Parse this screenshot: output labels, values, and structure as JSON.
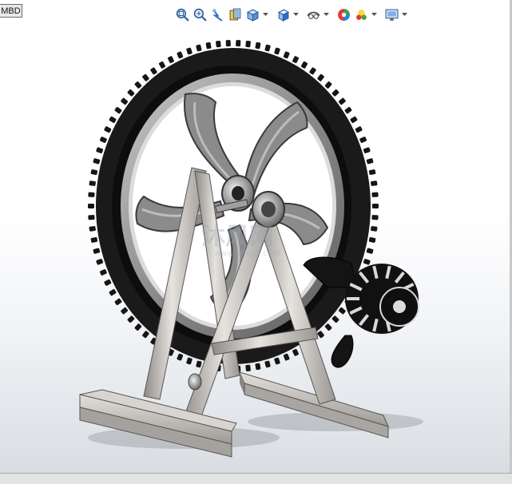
{
  "mbd_tab": {
    "label": "MBD"
  },
  "toolbar": {
    "buttons": [
      {
        "icon": "zoom-to-fit-icon"
      },
      {
        "icon": "zoom-to-area-icon"
      },
      {
        "icon": "previous-view-icon"
      },
      {
        "icon": "section-view-icon"
      },
      {
        "icon": "view-orientation-icon"
      },
      {
        "icon": "display-style-icon"
      },
      {
        "icon": "hide-show-items-icon"
      },
      {
        "icon": "edit-appearance-icon"
      },
      {
        "icon": "apply-scene-icon"
      },
      {
        "icon": "view-settings-icon"
      }
    ]
  },
  "watermark": {
    "text": "沐风网",
    "url": "www.mfcad.com"
  },
  "colors": {
    "tire": "#111111",
    "rim": "#8c8c8c",
    "frame": "#c9c5c1",
    "motor": "#151515",
    "toolbar_blue": "#2f6fc9"
  }
}
